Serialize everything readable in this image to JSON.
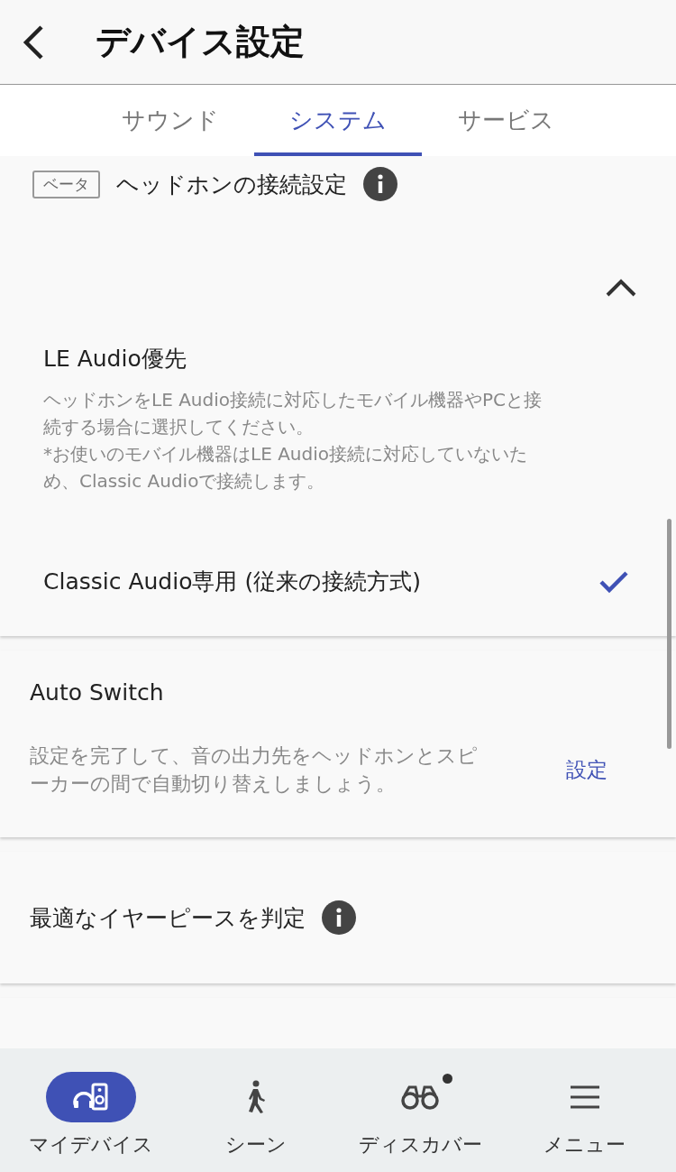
{
  "header": {
    "title": "デバイス設定"
  },
  "tabs": [
    {
      "label": "サウンド",
      "selected": false
    },
    {
      "label": "システム",
      "selected": true
    },
    {
      "label": "サービス",
      "selected": false
    }
  ],
  "connection": {
    "badge": "ベータ",
    "title": "ヘッドホンの接続設定",
    "expanded": true,
    "options": [
      {
        "label": "LE Audio優先",
        "description": "ヘッドホンをLE Audio接続に対応したモバイル機器やPCと接続する場合に選択してください。\n*お使いのモバイル機器はLE Audio接続に対応していないため、Classic Audioで接続します。",
        "selected": false
      },
      {
        "label": "Classic Audio専用 (従来の接続方式)",
        "selected": true
      }
    ]
  },
  "auto_switch": {
    "title": "Auto Switch",
    "description": "設定を完了して、音の出力先をヘッドホンとスピーカーの間で自動切り替えしましょう。",
    "action": "設定"
  },
  "earpiece": {
    "title": "最適なイヤーピースを判定"
  },
  "nav": [
    {
      "kind": "devices",
      "label": "マイデバイス",
      "selected": true,
      "dot": false
    },
    {
      "kind": "scene",
      "label": "シーン",
      "selected": false,
      "dot": false
    },
    {
      "kind": "discover",
      "label": "ディスカバー",
      "selected": false,
      "dot": true
    },
    {
      "kind": "menu",
      "label": "メニュー",
      "selected": false,
      "dot": false
    }
  ]
}
